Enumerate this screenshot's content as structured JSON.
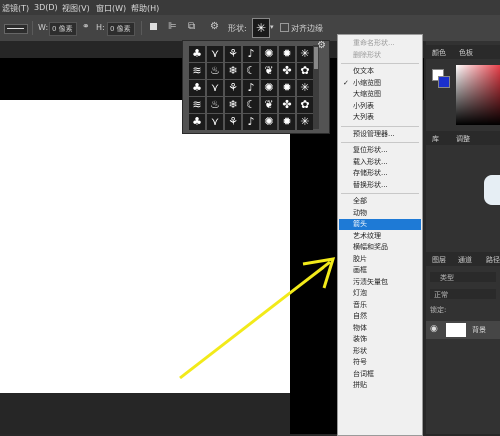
{
  "menubar": {
    "items": [
      "滤镜(T)",
      "3D(D)",
      "视图(V)",
      "窗口(W)",
      "帮助(H)"
    ]
  },
  "options": {
    "w_label": "W:",
    "w_value": "0 像素",
    "link_icon": "link-icon",
    "h_label": "H:",
    "h_value": "0 像素",
    "shape_label": "形状:",
    "align_label": "对齐边缘"
  },
  "picker": {
    "shapes": [
      "tree-icon",
      "grass-icon",
      "butterfly-icon",
      "music-note-icon",
      "seal-icon",
      "burst-icon",
      "star-burst-icon",
      "waves-icon",
      "flame-icon",
      "snowflake-icon",
      "crescent-moon-icon",
      "leaf-icon",
      "maple-leaf-icon",
      "paw-icon"
    ]
  },
  "menu": {
    "items": [
      {
        "label": "重命名形状...",
        "disabled": true
      },
      {
        "label": "删除形状",
        "disabled": true
      },
      {
        "sep": true
      },
      {
        "label": "仅文本"
      },
      {
        "label": "小缩览图",
        "checked": true
      },
      {
        "label": "大缩览图"
      },
      {
        "label": "小列表"
      },
      {
        "label": "大列表"
      },
      {
        "sep": true
      },
      {
        "label": "预设管理器..."
      },
      {
        "sep": true
      },
      {
        "label": "复位形状..."
      },
      {
        "label": "载入形状..."
      },
      {
        "label": "存储形状..."
      },
      {
        "label": "替换形状..."
      },
      {
        "sep": true
      },
      {
        "label": "全部"
      },
      {
        "label": "动物"
      },
      {
        "label": "箭头",
        "selected": true
      },
      {
        "label": "艺术纹理"
      },
      {
        "label": "横幅和奖品"
      },
      {
        "label": "胶片"
      },
      {
        "label": "画框"
      },
      {
        "label": "污渍矢量包"
      },
      {
        "label": "灯泡"
      },
      {
        "label": "音乐"
      },
      {
        "label": "自然"
      },
      {
        "label": "物体"
      },
      {
        "label": "装饰"
      },
      {
        "label": "形状"
      },
      {
        "label": "符号"
      },
      {
        "label": "台词框"
      },
      {
        "label": "拼贴"
      }
    ]
  },
  "panels": {
    "color_tab": "颜色",
    "swatches_tab": "色板",
    "library_tab": "库",
    "adjust_tab": "调整",
    "layers_tab": "图层",
    "channels_tab": "通道",
    "paths_tab": "路径",
    "type_filter": "类型",
    "blend_mode": "正常",
    "lock_label": "锁定:",
    "layer_name": "背景"
  },
  "colors": {
    "accent": "#1e7ad6",
    "arrow": "#f2ea1a"
  }
}
